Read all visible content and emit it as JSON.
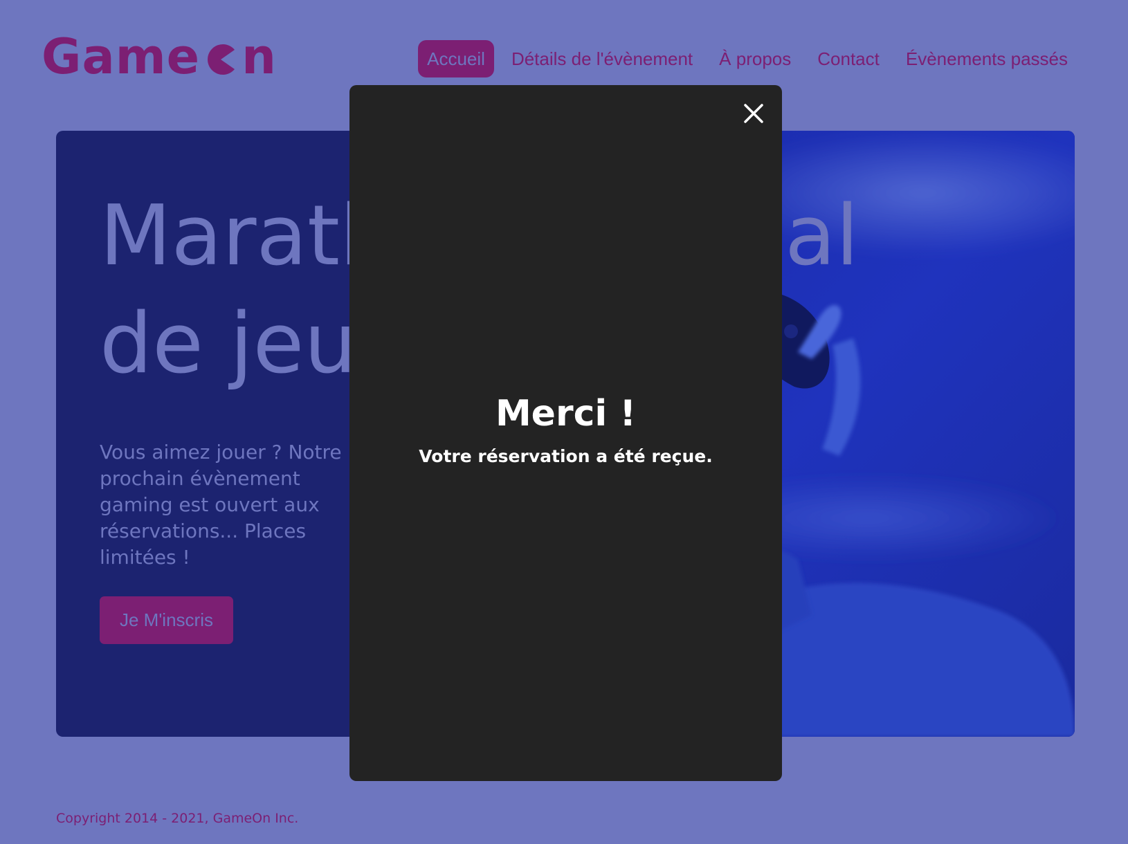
{
  "header": {
    "logo_text_left": "Game",
    "logo_text_right": "n",
    "logo_icon": "pacman-o-icon",
    "nav": [
      {
        "label": "Accueil",
        "active": true
      },
      {
        "label": "Détails de l'évènement",
        "active": false
      },
      {
        "label": "À propos",
        "active": false
      },
      {
        "label": "Contact",
        "active": false
      },
      {
        "label": "Évènements passés",
        "active": false
      }
    ]
  },
  "hero": {
    "title": "Marathon national de jeux vidéos",
    "title_line1": "Marathon national",
    "title_line2": "de jeux vidéos",
    "text": "Vous aimez jouer ? Notre prochain évènement gaming est ouvert aux réservations... Places limitées !",
    "button_label": "Je M'inscris",
    "image_description_icon": "gamer-with-controller-photo"
  },
  "footer": {
    "copyright": "Copyright 2014 - 2021, GameOn Inc."
  },
  "modal": {
    "title": "Merci !",
    "text": "Votre réservation a été reçue.",
    "close_icon": "close-icon"
  },
  "colors": {
    "page_background": "#6e76bf",
    "brand_purple": "#7c1f73",
    "hero_background": "#1c2370",
    "modal_background": "#232323",
    "modal_text": "#ffffff"
  }
}
